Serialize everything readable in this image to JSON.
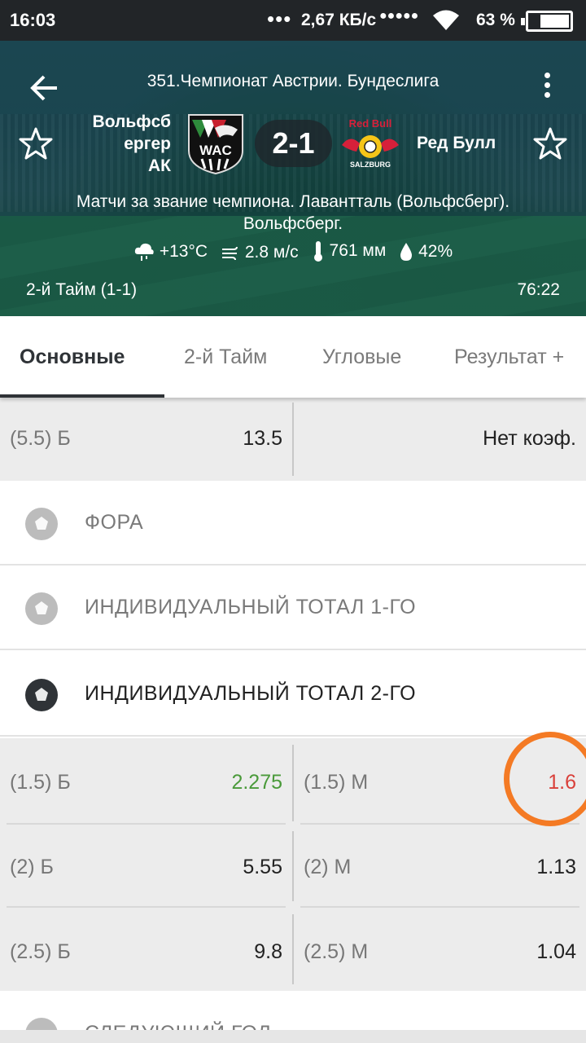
{
  "status_bar": {
    "time": "16:03",
    "dots": "•••",
    "speed": "2,67 КБ/с",
    "signal": "●●●●●",
    "battery": "63 %"
  },
  "match": {
    "league": "351.Чемпионат Австрии. Бундеслига",
    "team1_line1": "Вольфсб",
    "team1_line2": "ергер",
    "team1_line3": "АК",
    "team1_logo_text": "WAC",
    "score": "2-1",
    "team2": "Ред Булл",
    "team2_logo_top": "Red Bull",
    "team2_logo_bottom": "SALZBURG",
    "venue_line1": "Матчи за звание чемпиона. Лавантталь (Вольфсберг).",
    "venue_line2": "Вольфсберг.",
    "temperature": "+13°C",
    "wind": "2.8 м/с",
    "pressure": "761 мм",
    "humidity": "42%",
    "period": "2-й  Тайм (1-1)",
    "clock": "76:22"
  },
  "tabs": [
    {
      "label": "Основные"
    },
    {
      "label": "2-й  Тайм"
    },
    {
      "label": "Угловые"
    },
    {
      "label": "Результат +"
    }
  ],
  "top_row": {
    "left_label": "(5.5) Б",
    "left_value": "13.5",
    "right_value": "Нет коэф."
  },
  "sections": [
    {
      "title": "ФОРА"
    },
    {
      "title": "ИНДИВИДУАЛЬНЫЙ ТОТАЛ 1-ГО"
    },
    {
      "title": "ИНДИВИДУАЛЬНЫЙ ТОТАЛ 2-ГО"
    },
    {
      "title": "СЛЕДУЮЩИЙ ГОЛ"
    }
  ],
  "total2_rows": [
    {
      "left_label": "(1.5) Б",
      "left_value": "2.275",
      "right_label": "(1.5) М",
      "right_value": "1.6"
    },
    {
      "left_label": "(2) Б",
      "left_value": "5.55",
      "right_label": "(2) М",
      "right_value": "1.13"
    },
    {
      "left_label": "(2.5) Б",
      "left_value": "9.8",
      "right_label": "(2.5) М",
      "right_value": "1.04"
    }
  ],
  "colors": {
    "odds_up": "#4a9a3a",
    "odds_down": "#d9403a",
    "highlight_circle": "#f47a24"
  }
}
